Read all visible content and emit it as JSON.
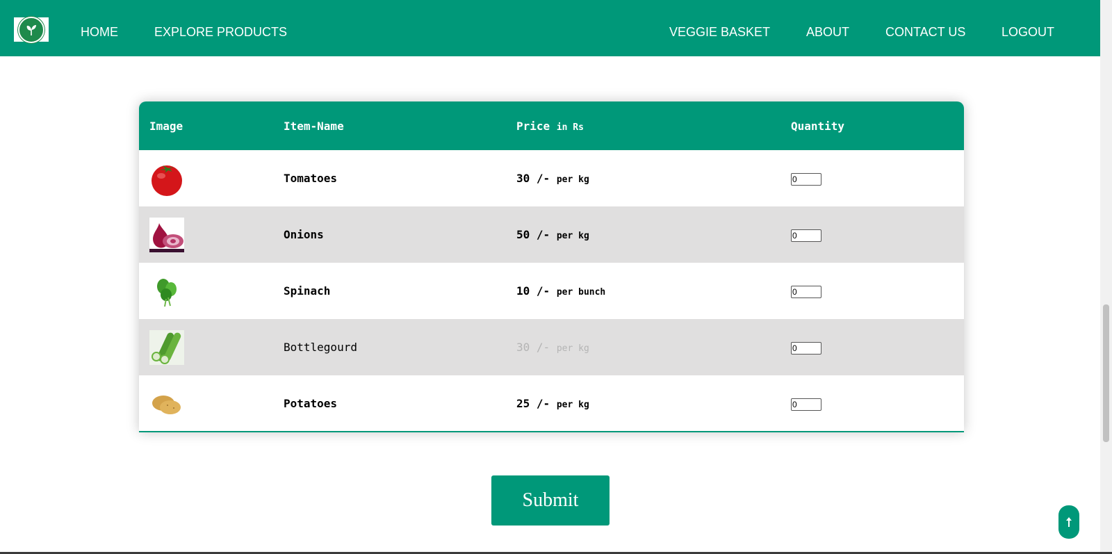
{
  "nav": {
    "logo_icon": "leaf-logo-icon",
    "left_links": [
      "HOME",
      "EXPLORE PRODUCTS"
    ],
    "right_links": [
      "VEGGIE BASKET",
      "ABOUT",
      "CONTACT US",
      "LOGOUT"
    ]
  },
  "table": {
    "headers": {
      "image": "Image",
      "item_name": "Item-Name",
      "price": "Price",
      "price_unit": "in Rs",
      "quantity": "Quantity"
    },
    "rows": [
      {
        "image": "tomato-image",
        "name": "Tomatoes",
        "price": "30 /-",
        "unit": "per kg",
        "qty": "0"
      },
      {
        "image": "onion-image",
        "name": "Onions",
        "price": "50 /-",
        "unit": "per kg",
        "qty": "0"
      },
      {
        "image": "spinach-image",
        "name": "Spinach",
        "price": "10 /-",
        "unit": "per bunch",
        "qty": "0"
      },
      {
        "image": "bottlegourd-image",
        "name": "Bottlegourd",
        "price": "30 /-",
        "unit": "per kg",
        "qty": "0"
      },
      {
        "image": "potato-image",
        "name": "Potatoes",
        "price": "25 /-",
        "unit": "per kg",
        "qty": "0"
      }
    ]
  },
  "submit_label": "Submit",
  "scroll_top_icon": "arrow-up-icon",
  "colors": {
    "brand": "#009879",
    "row_alt": "#e0dfdf",
    "dim_text": "#b4b4b4"
  }
}
